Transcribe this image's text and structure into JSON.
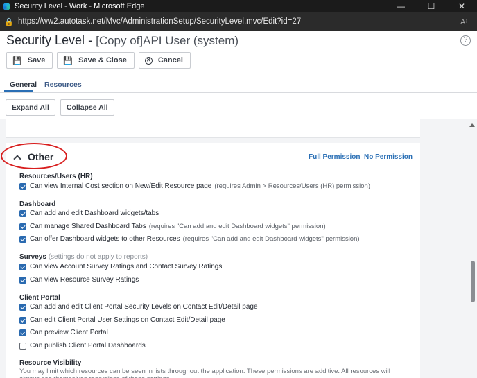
{
  "window": {
    "title": "Security Level - Work - Microsoft Edge",
    "url": "https://ww2.autotask.net/Mvc/AdministrationSetup/SecurityLevel.mvc/Edit?id=27"
  },
  "header": {
    "title": "Security Level",
    "separator": "-",
    "subtitle": "[Copy of]API User (system)"
  },
  "toolbar": {
    "save_label": "Save",
    "save_close_label": "Save & Close",
    "cancel_label": "Cancel"
  },
  "tabs": [
    {
      "label": "General",
      "active": true
    },
    {
      "label": "Resources",
      "active": false
    }
  ],
  "actions": {
    "expand_all": "Expand All",
    "collapse_all": "Collapse All"
  },
  "section": {
    "title": "Other",
    "full_permission": "Full Permission",
    "no_permission": "No Permission",
    "groups": [
      {
        "name": "Resources/Users (HR)",
        "options": [
          {
            "label": "Can view Internal Cost section on New/Edit Resource page",
            "note": "(requires Admin > Resources/Users (HR) permission)",
            "checked": true
          }
        ]
      },
      {
        "name": "Dashboard",
        "options": [
          {
            "label": "Can add and edit Dashboard widgets/tabs",
            "checked": true
          },
          {
            "label": "Can manage Shared Dashboard Tabs",
            "note": "(requires \"Can add and edit Dashboard widgets\" permission)",
            "checked": true
          },
          {
            "label": "Can offer Dashboard widgets to other Resources",
            "note": "(requires \"Can add and edit Dashboard widgets\" permission)",
            "checked": true
          }
        ]
      },
      {
        "name": "Surveys",
        "name_note": "(settings do not apply to reports)",
        "options": [
          {
            "label": "Can view Account Survey Ratings and Contact Survey Ratings",
            "checked": true
          },
          {
            "label": "Can view Resource Survey Ratings",
            "checked": true
          }
        ]
      },
      {
        "name": "Client Portal",
        "options": [
          {
            "label": "Can add and edit Client Portal Security Levels on Contact Edit/Detail page",
            "checked": true
          },
          {
            "label": "Can edit Client Portal User Settings on Contact Edit/Detail page",
            "checked": true
          },
          {
            "label": "Can preview Client Portal",
            "checked": true
          },
          {
            "label": "Can publish Client Portal Dashboards",
            "checked": false
          }
        ]
      },
      {
        "name": "Resource Visibility",
        "description": "You may limit which resources can be seen in lists throughout the application. These permissions are additive. All resources will always see themselves regardless of these settings."
      }
    ]
  },
  "colors": {
    "accent": "#2a6fb5",
    "checkbox": "#2a6ab0",
    "annotation": "#d81e1e"
  }
}
